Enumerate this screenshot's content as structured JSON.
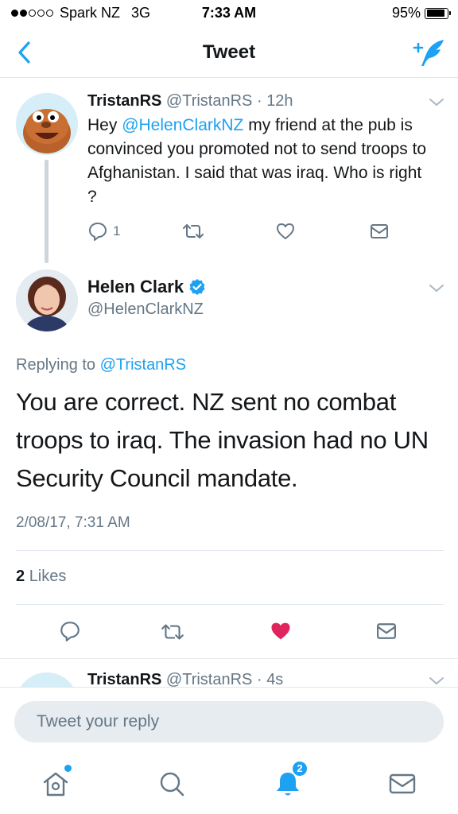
{
  "status_bar": {
    "carrier": "Spark NZ",
    "network": "3G",
    "time": "7:33 AM",
    "battery": "95%",
    "battery_level": 0.95
  },
  "nav": {
    "title": "Tweet",
    "back_icon": "chevron-left-icon",
    "compose_icon": "compose-tweet-icon"
  },
  "parent_tweet": {
    "name": "TristanRS",
    "handle": "@TristanRS",
    "separator": "·",
    "age": "12h",
    "text_prefix": "Hey ",
    "mention": "@HelenClarkNZ",
    "text_rest": " my friend at the pub is convinced you promoted not to send troops to Afghanistan. I said that was iraq. Who is right ?",
    "reply_count": "1"
  },
  "main_tweet": {
    "name": "Helen Clark",
    "handle": "@HelenClarkNZ",
    "replying_label": "Replying to ",
    "replying_to": "@TristanRS",
    "text": "You are correct. NZ sent no combat troops to iraq. The invasion had no UN Security Council mandate.",
    "timestamp": "2/08/17, 7:31 AM",
    "likes_count": "2",
    "likes_label": "Likes"
  },
  "next_tweet": {
    "name": "TristanRS",
    "handle": "@TristanRS",
    "separator": "·",
    "age": "4s"
  },
  "reply_bar": {
    "placeholder": "Tweet your reply"
  },
  "tab_bar": {
    "notifications_badge": "2"
  },
  "colors": {
    "accent": "#1da1f2",
    "like": "#e0245e",
    "muted": "#657786",
    "divider": "#e1e8ed"
  }
}
